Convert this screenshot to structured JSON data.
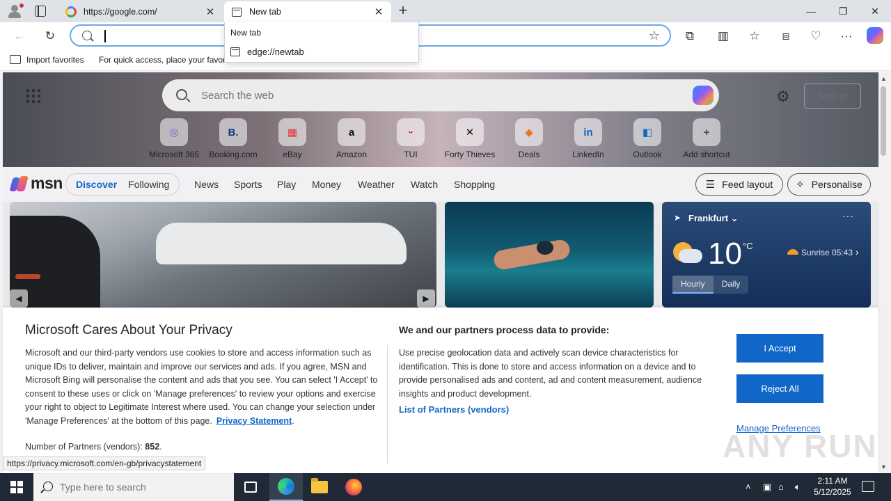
{
  "browser": {
    "tabs": [
      {
        "title": "https://google.com/",
        "icon": "google-icon"
      },
      {
        "title": "New tab",
        "icon": "newtab-icon"
      }
    ],
    "address": {
      "value": "",
      "placeholder": ""
    },
    "suggestion": {
      "header": "New tab",
      "item": "edge://newtab"
    },
    "favorites": {
      "import_label": "Import favorites",
      "hint": "For quick access, place your favorites here on the favorites bar."
    }
  },
  "hero": {
    "search_placeholder": "Search the web",
    "signin_label": "Sign in",
    "shortcuts": [
      {
        "label": "Microsoft 365",
        "glyph": "◎",
        "color": "#6b5bd6"
      },
      {
        "label": "Booking.com",
        "glyph": "B.",
        "color": "#0b3a8c"
      },
      {
        "label": "eBay",
        "glyph": "▦",
        "color": "#e53238"
      },
      {
        "label": "Amazon",
        "glyph": "a",
        "color": "#111111"
      },
      {
        "label": "TUI",
        "glyph": "ᵕ",
        "color": "#d40e14"
      },
      {
        "label": "Forty Thieves",
        "glyph": "✕",
        "color": "#111111"
      },
      {
        "label": "Deals",
        "glyph": "◆",
        "color": "#e8742a"
      },
      {
        "label": "LinkedIn",
        "glyph": "in",
        "color": "#0a66c2"
      },
      {
        "label": "Outlook",
        "glyph": "◧",
        "color": "#0f6cbd"
      },
      {
        "label": "Add shortcut",
        "glyph": "+",
        "color": "#444444"
      }
    ]
  },
  "feed": {
    "brand": "msn",
    "tabs": [
      "Discover",
      "Following"
    ],
    "nav": [
      "News",
      "Sports",
      "Play",
      "Money",
      "Weather",
      "Watch",
      "Shopping"
    ],
    "feed_layout_label": "Feed layout",
    "personalise_label": "Personalise"
  },
  "weather": {
    "location": "Frankfurt",
    "temperature": "10",
    "unit": "°C",
    "sunrise": "Sunrise 05:43",
    "tabs": [
      "Hourly",
      "Daily"
    ]
  },
  "consent": {
    "title": "Microsoft Cares About Your Privacy",
    "body": "Microsoft and our third-party vendors use cookies to store and access information such as unique IDs to deliver, maintain and improve our services and ads. If you agree, MSN and Microsoft Bing will personalise the content and ads that you see. You can select 'I Accept' to consent to these uses or click on 'Manage preferences' to review your options and exercise your right to object to Legitimate Interest where used.  You can change your selection under 'Manage Preferences' at the bottom of this page.",
    "privacy_link": "Privacy Statement",
    "partners_label": "Number of Partners (vendors):",
    "partners_count": "852",
    "right_title": "We and our partners process data to provide:",
    "right_body": "Use precise geolocation data and actively scan device characteristics for identification. This is done to store and access information on a device and to provide personalised ads and content, ad and content measurement, audience insights and product development.",
    "vendors_link": "List of Partners (vendors)",
    "accept_label": "I Accept",
    "reject_label": "Reject All",
    "manage_label": "Manage Preferences",
    "watermark": "ANY RUN"
  },
  "status_url": "https://privacy.microsoft.com/en-gb/privacystatement",
  "taskbar": {
    "search_placeholder": "Type here to search",
    "time": "2:11 AM",
    "date": "5/12/2025"
  }
}
